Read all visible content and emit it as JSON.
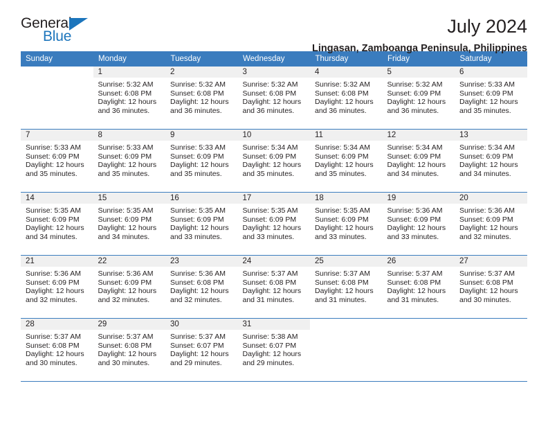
{
  "brand": {
    "name_part1": "General",
    "name_part2": "Blue",
    "accent_color": "#1c75bc"
  },
  "header": {
    "title": "July 2024",
    "location": "Lingasan, Zamboanga Peninsula, Philippines"
  },
  "theme": {
    "header_row_color": "#3a7cbe",
    "day_number_background": "#f0f0f0"
  },
  "calendar": {
    "weekday_headers": [
      "Sunday",
      "Monday",
      "Tuesday",
      "Wednesday",
      "Thursday",
      "Friday",
      "Saturday"
    ],
    "weeks": [
      [
        {
          "day": "",
          "empty": true
        },
        {
          "day": "1",
          "sunrise": "Sunrise: 5:32 AM",
          "sunset": "Sunset: 6:08 PM",
          "daylight1": "Daylight: 12 hours",
          "daylight2": "and 36 minutes."
        },
        {
          "day": "2",
          "sunrise": "Sunrise: 5:32 AM",
          "sunset": "Sunset: 6:08 PM",
          "daylight1": "Daylight: 12 hours",
          "daylight2": "and 36 minutes."
        },
        {
          "day": "3",
          "sunrise": "Sunrise: 5:32 AM",
          "sunset": "Sunset: 6:08 PM",
          "daylight1": "Daylight: 12 hours",
          "daylight2": "and 36 minutes."
        },
        {
          "day": "4",
          "sunrise": "Sunrise: 5:32 AM",
          "sunset": "Sunset: 6:08 PM",
          "daylight1": "Daylight: 12 hours",
          "daylight2": "and 36 minutes."
        },
        {
          "day": "5",
          "sunrise": "Sunrise: 5:32 AM",
          "sunset": "Sunset: 6:09 PM",
          "daylight1": "Daylight: 12 hours",
          "daylight2": "and 36 minutes."
        },
        {
          "day": "6",
          "sunrise": "Sunrise: 5:33 AM",
          "sunset": "Sunset: 6:09 PM",
          "daylight1": "Daylight: 12 hours",
          "daylight2": "and 35 minutes."
        }
      ],
      [
        {
          "day": "7",
          "sunrise": "Sunrise: 5:33 AM",
          "sunset": "Sunset: 6:09 PM",
          "daylight1": "Daylight: 12 hours",
          "daylight2": "and 35 minutes."
        },
        {
          "day": "8",
          "sunrise": "Sunrise: 5:33 AM",
          "sunset": "Sunset: 6:09 PM",
          "daylight1": "Daylight: 12 hours",
          "daylight2": "and 35 minutes."
        },
        {
          "day": "9",
          "sunrise": "Sunrise: 5:33 AM",
          "sunset": "Sunset: 6:09 PM",
          "daylight1": "Daylight: 12 hours",
          "daylight2": "and 35 minutes."
        },
        {
          "day": "10",
          "sunrise": "Sunrise: 5:34 AM",
          "sunset": "Sunset: 6:09 PM",
          "daylight1": "Daylight: 12 hours",
          "daylight2": "and 35 minutes."
        },
        {
          "day": "11",
          "sunrise": "Sunrise: 5:34 AM",
          "sunset": "Sunset: 6:09 PM",
          "daylight1": "Daylight: 12 hours",
          "daylight2": "and 35 minutes."
        },
        {
          "day": "12",
          "sunrise": "Sunrise: 5:34 AM",
          "sunset": "Sunset: 6:09 PM",
          "daylight1": "Daylight: 12 hours",
          "daylight2": "and 34 minutes."
        },
        {
          "day": "13",
          "sunrise": "Sunrise: 5:34 AM",
          "sunset": "Sunset: 6:09 PM",
          "daylight1": "Daylight: 12 hours",
          "daylight2": "and 34 minutes."
        }
      ],
      [
        {
          "day": "14",
          "sunrise": "Sunrise: 5:35 AM",
          "sunset": "Sunset: 6:09 PM",
          "daylight1": "Daylight: 12 hours",
          "daylight2": "and 34 minutes."
        },
        {
          "day": "15",
          "sunrise": "Sunrise: 5:35 AM",
          "sunset": "Sunset: 6:09 PM",
          "daylight1": "Daylight: 12 hours",
          "daylight2": "and 34 minutes."
        },
        {
          "day": "16",
          "sunrise": "Sunrise: 5:35 AM",
          "sunset": "Sunset: 6:09 PM",
          "daylight1": "Daylight: 12 hours",
          "daylight2": "and 33 minutes."
        },
        {
          "day": "17",
          "sunrise": "Sunrise: 5:35 AM",
          "sunset": "Sunset: 6:09 PM",
          "daylight1": "Daylight: 12 hours",
          "daylight2": "and 33 minutes."
        },
        {
          "day": "18",
          "sunrise": "Sunrise: 5:35 AM",
          "sunset": "Sunset: 6:09 PM",
          "daylight1": "Daylight: 12 hours",
          "daylight2": "and 33 minutes."
        },
        {
          "day": "19",
          "sunrise": "Sunrise: 5:36 AM",
          "sunset": "Sunset: 6:09 PM",
          "daylight1": "Daylight: 12 hours",
          "daylight2": "and 33 minutes."
        },
        {
          "day": "20",
          "sunrise": "Sunrise: 5:36 AM",
          "sunset": "Sunset: 6:09 PM",
          "daylight1": "Daylight: 12 hours",
          "daylight2": "and 32 minutes."
        }
      ],
      [
        {
          "day": "21",
          "sunrise": "Sunrise: 5:36 AM",
          "sunset": "Sunset: 6:09 PM",
          "daylight1": "Daylight: 12 hours",
          "daylight2": "and 32 minutes."
        },
        {
          "day": "22",
          "sunrise": "Sunrise: 5:36 AM",
          "sunset": "Sunset: 6:09 PM",
          "daylight1": "Daylight: 12 hours",
          "daylight2": "and 32 minutes."
        },
        {
          "day": "23",
          "sunrise": "Sunrise: 5:36 AM",
          "sunset": "Sunset: 6:08 PM",
          "daylight1": "Daylight: 12 hours",
          "daylight2": "and 32 minutes."
        },
        {
          "day": "24",
          "sunrise": "Sunrise: 5:37 AM",
          "sunset": "Sunset: 6:08 PM",
          "daylight1": "Daylight: 12 hours",
          "daylight2": "and 31 minutes."
        },
        {
          "day": "25",
          "sunrise": "Sunrise: 5:37 AM",
          "sunset": "Sunset: 6:08 PM",
          "daylight1": "Daylight: 12 hours",
          "daylight2": "and 31 minutes."
        },
        {
          "day": "26",
          "sunrise": "Sunrise: 5:37 AM",
          "sunset": "Sunset: 6:08 PM",
          "daylight1": "Daylight: 12 hours",
          "daylight2": "and 31 minutes."
        },
        {
          "day": "27",
          "sunrise": "Sunrise: 5:37 AM",
          "sunset": "Sunset: 6:08 PM",
          "daylight1": "Daylight: 12 hours",
          "daylight2": "and 30 minutes."
        }
      ],
      [
        {
          "day": "28",
          "sunrise": "Sunrise: 5:37 AM",
          "sunset": "Sunset: 6:08 PM",
          "daylight1": "Daylight: 12 hours",
          "daylight2": "and 30 minutes."
        },
        {
          "day": "29",
          "sunrise": "Sunrise: 5:37 AM",
          "sunset": "Sunset: 6:08 PM",
          "daylight1": "Daylight: 12 hours",
          "daylight2": "and 30 minutes."
        },
        {
          "day": "30",
          "sunrise": "Sunrise: 5:37 AM",
          "sunset": "Sunset: 6:07 PM",
          "daylight1": "Daylight: 12 hours",
          "daylight2": "and 29 minutes."
        },
        {
          "day": "31",
          "sunrise": "Sunrise: 5:38 AM",
          "sunset": "Sunset: 6:07 PM",
          "daylight1": "Daylight: 12 hours",
          "daylight2": "and 29 minutes."
        },
        {
          "day": "",
          "empty": true
        },
        {
          "day": "",
          "empty": true
        },
        {
          "day": "",
          "empty": true
        }
      ]
    ]
  }
}
